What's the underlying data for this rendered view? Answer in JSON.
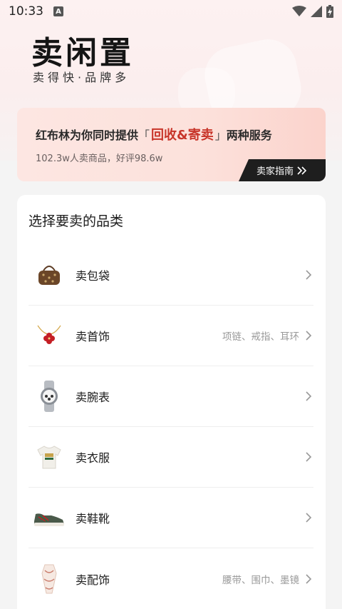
{
  "status": {
    "time": "10:33",
    "notification_icon": "A"
  },
  "header": {
    "title": "卖闲置",
    "subtitle": "卖得快·品牌多"
  },
  "promo": {
    "prefix": "红布林为你同时提供",
    "bracket_open": "「",
    "highlight": "回收&寄卖",
    "bracket_close": "」",
    "suffix": "两种服务",
    "stats": "102.3w人卖商品，好评98.6w",
    "guide_label": "卖家指南",
    "accent_color": "#c8352a"
  },
  "category_panel": {
    "title": "选择要卖的品类",
    "items": [
      {
        "label": "卖包袋",
        "hint": "",
        "icon": "handbag-icon"
      },
      {
        "label": "卖首饰",
        "hint": "项链、戒指、耳环",
        "icon": "necklace-icon"
      },
      {
        "label": "卖腕表",
        "hint": "",
        "icon": "watch-icon"
      },
      {
        "label": "卖衣服",
        "hint": "",
        "icon": "tshirt-icon"
      },
      {
        "label": "卖鞋靴",
        "hint": "",
        "icon": "sneaker-icon"
      },
      {
        "label": "卖配饰",
        "hint": "腰带、围巾、墨镜",
        "icon": "scarf-icon"
      }
    ]
  }
}
